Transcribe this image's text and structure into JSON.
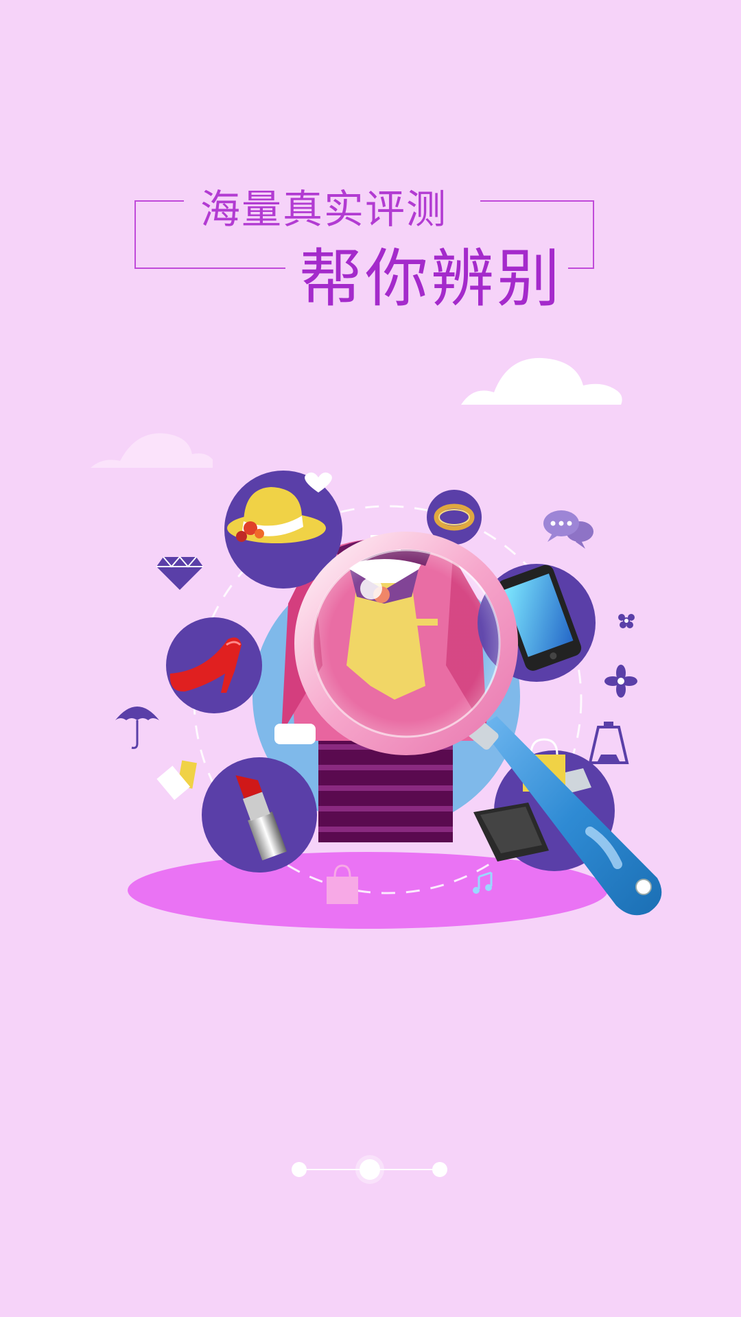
{
  "headline": {
    "line1": "海量真实评测",
    "line2": "帮你辨别"
  },
  "illustration": {
    "center_item": "jacket-icon",
    "tool": "magnifier-icon",
    "items": [
      "hat-icon",
      "ring-icon",
      "phone-icon",
      "high-heel-icon",
      "lipstick-icon",
      "laptop-icon",
      "shopping-bag-icon",
      "diamond-icon",
      "umbrella-icon",
      "chat-bubble-icon",
      "flower-icon",
      "perfume-icon",
      "music-note-icon",
      "heart-icon",
      "cloud-icon"
    ]
  },
  "pager": {
    "count": 3,
    "active_index": 1
  },
  "colors": {
    "background": "#f6d3f9",
    "title": "#b23bd2",
    "circle_purple": "#5a3fa8",
    "center_blue": "#7fb9ea",
    "base_pink": "#ea73f4",
    "magnifier_handle": "#2f8bd4"
  }
}
